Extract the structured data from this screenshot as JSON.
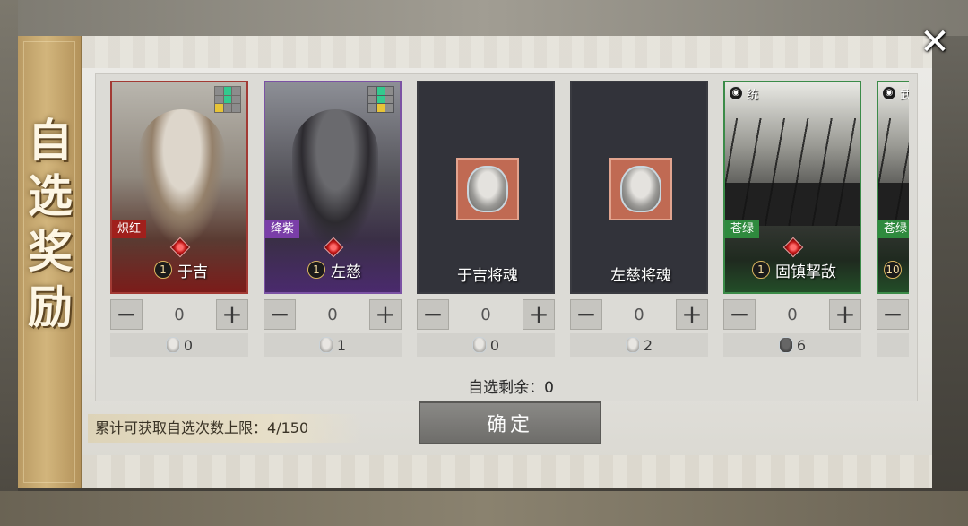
{
  "banner": {
    "title": "自\n选\n奖\n励"
  },
  "close": {
    "glyph": "✕"
  },
  "cards": [
    {
      "style": "red",
      "tag": "炽红",
      "level": "1",
      "name": "于吉",
      "count": "0",
      "owned": "0",
      "icon": "hero-portrait",
      "grid": [
        "",
        "g",
        "",
        "",
        "g",
        "",
        "y",
        "",
        ""
      ]
    },
    {
      "style": "purple",
      "tag": "绛紫",
      "level": "1",
      "name": "左慈",
      "count": "0",
      "owned": "1",
      "icon": "hero-portrait",
      "grid": [
        "",
        "g",
        "",
        "",
        "g",
        "",
        "",
        "y",
        ""
      ]
    },
    {
      "style": "dark",
      "tag": "",
      "level": "",
      "name": "于吉将魂",
      "count": "0",
      "owned": "0",
      "icon": "hero-soul"
    },
    {
      "style": "dark",
      "tag": "",
      "level": "",
      "name": "左慈将魂",
      "count": "0",
      "owned": "2",
      "icon": "hero-soul"
    },
    {
      "style": "green",
      "tag": "苍绿",
      "level": "1",
      "name": "固镇挈敌",
      "count": "0",
      "owned": "6",
      "badge": "统",
      "icon": "tactic-card"
    },
    {
      "style": "green",
      "tag": "苍绿",
      "level": "10",
      "name": "",
      "count": "0",
      "owned": "",
      "badge": "武",
      "icon": "tactic-card"
    }
  ],
  "stepper": {
    "minus": "−",
    "plus": "+"
  },
  "remain": {
    "label": "自选剩余：",
    "value": "0"
  },
  "limit": {
    "label": "累计可获取自选次数上限：",
    "value": "4/150"
  },
  "confirm": {
    "label": "确定"
  }
}
